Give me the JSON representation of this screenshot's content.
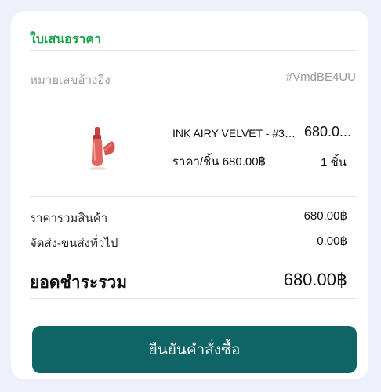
{
  "quote": {
    "title": "ใบเสนอราคา",
    "reference_label": "หมายเลขอ้างอิง",
    "reference_value": "#VmdBE4UU"
  },
  "item": {
    "image_icon": "lip-tint-bottle-image",
    "name": "INK AIRY VELVET - #3 ...",
    "total": "680.0...",
    "unit_price": "ราคา/ชิ้น 680.00฿",
    "quantity": "1 ชิ้น"
  },
  "summary": {
    "subtotal_label": "ราคารวมสินค้า",
    "subtotal_value": "680.00฿",
    "shipping_label": "จัดส่ง-ขนส่งทั่วไป",
    "shipping_value": "0.00฿",
    "grand_total_label": "ยอดชำระรวม",
    "grand_total_value": "680.00฿"
  },
  "actions": {
    "confirm_label": "ยืนยันคำสั่งซื้อ"
  },
  "colors": {
    "title_green": "#17a34a",
    "button_teal": "#0f6566",
    "background": "#eef1fb"
  }
}
